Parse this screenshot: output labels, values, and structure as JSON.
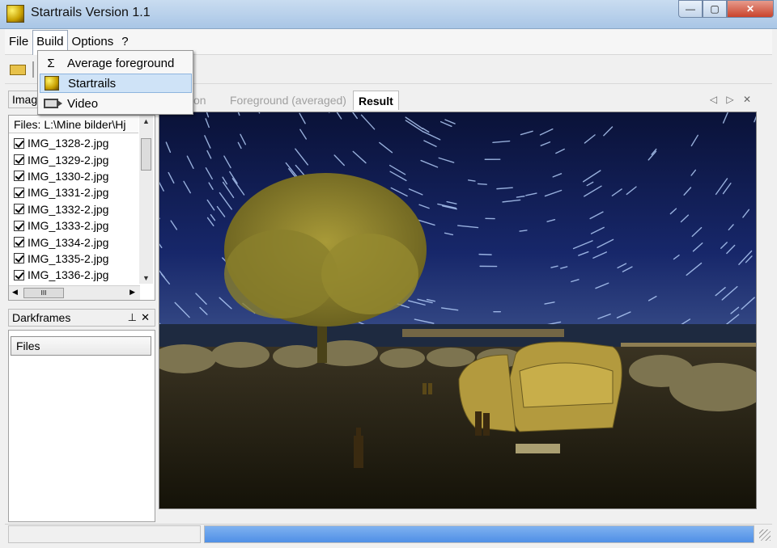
{
  "window": {
    "title": "Startrails Version 1.1",
    "controls": {
      "minimize": "—",
      "maximize": "▢",
      "close": "✕"
    }
  },
  "menubar": {
    "items": [
      "File",
      "Build",
      "Options",
      "?"
    ]
  },
  "build_menu": {
    "items": [
      {
        "icon": "sigma-icon",
        "glyph": "Σ",
        "label": "Average foreground",
        "highlighted": false
      },
      {
        "icon": "startrails-icon",
        "glyph": "",
        "label": "Startrails",
        "highlighted": true
      },
      {
        "icon": "video-camera-icon",
        "glyph": "",
        "label": "Video",
        "highlighted": false
      }
    ]
  },
  "left_panel": {
    "images_header": "Imag",
    "files_header": "Files: L:\\Mine bilder\\Hj",
    "files": [
      "IMG_1328-2.jpg",
      "IMG_1329-2.jpg",
      "IMG_1330-2.jpg",
      "IMG_1331-2.jpg",
      "IMG_1332-2.jpg",
      "IMG_1333-2.jpg",
      "IMG_1334-2.jpg",
      "IMG_1335-2.jpg",
      "IMG_1336-2.jpg"
    ],
    "hscroll_grip": "III",
    "darkframes_header": "Darkframes",
    "darkframes_files_label": "Files",
    "pin_glyph": "📌",
    "close_glyph": "✕"
  },
  "tabs": {
    "items": [
      {
        "label": "tion",
        "active": false
      },
      {
        "label": "Foreground (averaged)",
        "active": false
      },
      {
        "label": "Result",
        "active": true
      }
    ],
    "nav": "◁ ▷ ✕"
  },
  "statusbar": {
    "progress": 1.0
  },
  "colors": {
    "accent": "#cfe3f7",
    "progress": "#4f8fe6",
    "sky": "#0d1a44"
  }
}
